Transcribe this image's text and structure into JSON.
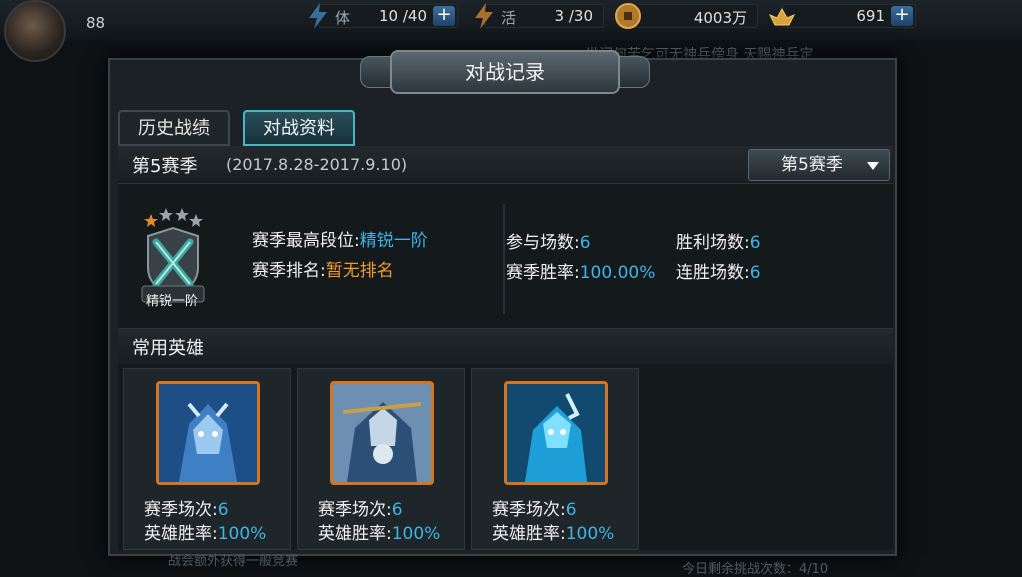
{
  "topbar": {
    "level": "88",
    "stamina": {
      "label": "体",
      "value": "10 /40"
    },
    "vitality": {
      "label": "活",
      "value": "3 /30"
    },
    "coins": {
      "value": "4003万"
    },
    "gems": {
      "value": "691"
    },
    "background_notice": "世间何苦乞可无神兵傍身 天赐神兵定"
  },
  "dialog": {
    "title": "对战记录",
    "tabs": [
      {
        "label": "历史战绩",
        "active": false
      },
      {
        "label": "对战资料",
        "active": true
      }
    ],
    "season": {
      "title": "第5赛季",
      "range": "(2017.8.28-2017.9.10)",
      "dropdown_selected": "第5赛季"
    },
    "rank": {
      "badge_label": "精锐一阶",
      "stars_filled": 1,
      "stars_total": 4,
      "highest_label": "赛季最高段位:",
      "highest_value": "精锐一阶",
      "ranking_label": "赛季排名:",
      "ranking_value": "暂无排名"
    },
    "stats": {
      "played_label": "参与场数:",
      "played_value": "6",
      "won_label": "胜利场数:",
      "won_value": "6",
      "winrate_label": "赛季胜率:",
      "winrate_value": "100.00%",
      "streak_label": "连胜场数:",
      "streak_value": "6"
    },
    "heroes_title": "常用英雄",
    "heroes": [
      {
        "games_label": "赛季场次:",
        "games_value": "6",
        "winrate_label": "英雄胜率:",
        "winrate_value": "100%"
      },
      {
        "games_label": "赛季场次:",
        "games_value": "6",
        "winrate_label": "英雄胜率:",
        "winrate_value": "100%"
      },
      {
        "games_label": "赛季场次:",
        "games_value": "6",
        "winrate_label": "英雄胜率:",
        "winrate_value": "100%"
      }
    ]
  },
  "background_footer": {
    "left": "战会额外获得一般竞赛",
    "right": "今日剩余挑战次数：4/10"
  },
  "colors": {
    "accent_blue": "#3fb4e6",
    "accent_orange": "#f39a2e",
    "tab_active_border": "#49b6c4"
  }
}
